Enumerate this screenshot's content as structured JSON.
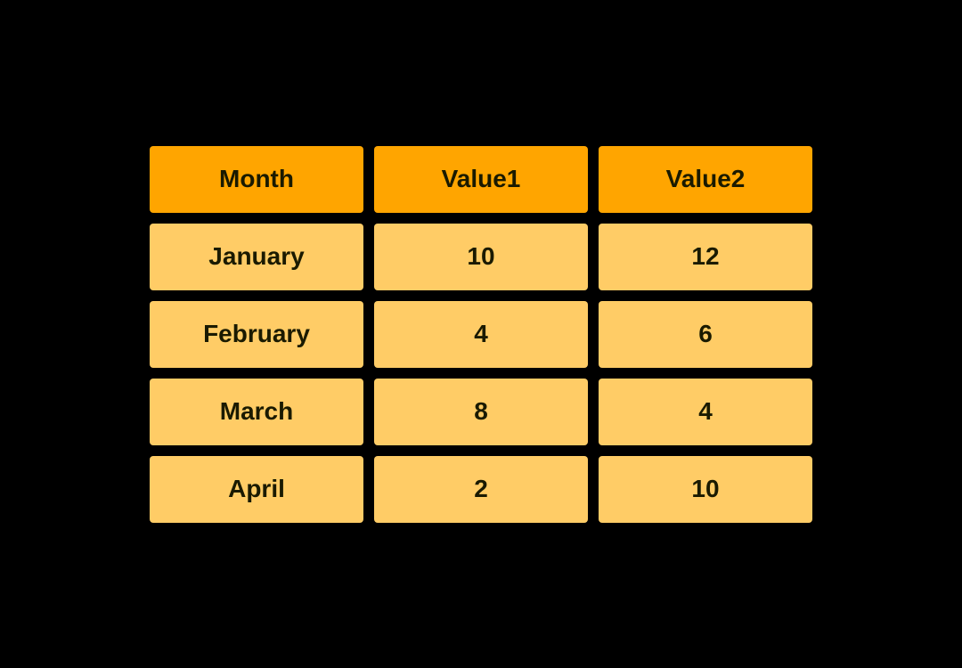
{
  "table": {
    "headers": [
      {
        "id": "month",
        "label": "Month"
      },
      {
        "id": "value1",
        "label": "Value1"
      },
      {
        "id": "value2",
        "label": "Value2"
      }
    ],
    "rows": [
      {
        "month": "January",
        "value1": "10",
        "value2": "12"
      },
      {
        "month": "February",
        "value1": "4",
        "value2": "6"
      },
      {
        "month": "March",
        "value1": "8",
        "value2": "4"
      },
      {
        "month": "April",
        "value1": "2",
        "value2": "10"
      }
    ]
  }
}
